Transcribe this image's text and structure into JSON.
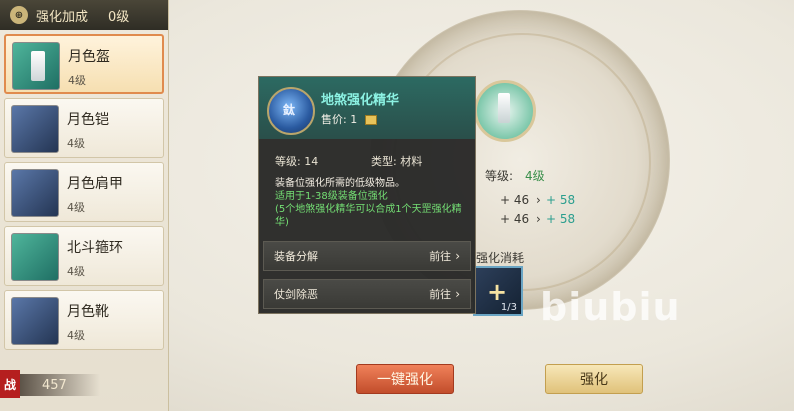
{
  "left_panel": {
    "header_label": "强化加成",
    "header_level": "0级",
    "items": [
      {
        "name": "月色盔",
        "level": "4级"
      },
      {
        "name": "月色铠",
        "level": "4级"
      },
      {
        "name": "月色肩甲",
        "level": "4级"
      },
      {
        "name": "北斗箍环",
        "level": "4级"
      },
      {
        "name": "月色靴",
        "level": "4级"
      }
    ],
    "power_label": "战",
    "power_value": "457"
  },
  "stats": {
    "level_label": "等级:",
    "level_value": "4级",
    "rows": [
      {
        "plus": "+ 46",
        "next": "+ 58"
      },
      {
        "plus": "+ 46",
        "next": "+ 58"
      }
    ],
    "consume_label": "强化消耗",
    "consume_count": "1/3"
  },
  "tooltip": {
    "title": "地煞强化精华",
    "price_label": "售价:",
    "price_value": "1",
    "level_text": "等级: 14",
    "type_text": "类型: 材料",
    "desc_main": "装备位强化所需的低级物品。",
    "desc_usage": "适用于1-38级装备位强化",
    "desc_note": "(5个地煞强化精华可以合成1个天罡强化精华)",
    "actions": [
      {
        "label": "装备分解",
        "go": "前往"
      },
      {
        "label": "仗剑除恶",
        "go": "前往"
      }
    ]
  },
  "buttons": {
    "one_click": "一键强化",
    "enhance": "强化"
  },
  "watermark": "biubiu",
  "colors": {
    "accent_red": "#c24d2b",
    "accent_gold": "#e0c27a",
    "teal": "#2c6a62",
    "green_text": "#74df74"
  }
}
